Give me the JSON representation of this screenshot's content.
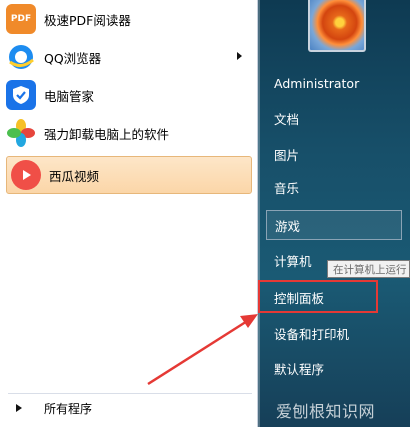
{
  "left_pane": {
    "apps": [
      {
        "label": "极速PDF阅读器",
        "icon": "pdf-icon",
        "color": "#f08a2a",
        "icon_text": "PDF"
      },
      {
        "label": "QQ浏览器",
        "icon": "browser-icon",
        "color": "#1d8cf0",
        "has_submenu": true
      },
      {
        "label": "电脑管家",
        "icon": "shield-icon",
        "color": "#1a73e8"
      },
      {
        "label": "强力卸载电脑上的软件",
        "icon": "petal-icon",
        "color": "#22a7e0"
      },
      {
        "label": "西瓜视频",
        "icon": "play-icon",
        "color": "#f04f47",
        "highlighted": true
      }
    ],
    "all_programs": "所有程序"
  },
  "right_pane": {
    "user": "Administrator",
    "items": [
      "文档",
      "图片",
      "音乐",
      "游戏",
      "计算机",
      "控制面板",
      "设备和打印机",
      "默认程序"
    ]
  },
  "tooltip": "在计算机上运行",
  "watermark": "爱刨根知识网",
  "colors": {
    "highlight": "#fbd6a8",
    "panel_blue": "#174f69",
    "annotation_red": "#e53935"
  }
}
